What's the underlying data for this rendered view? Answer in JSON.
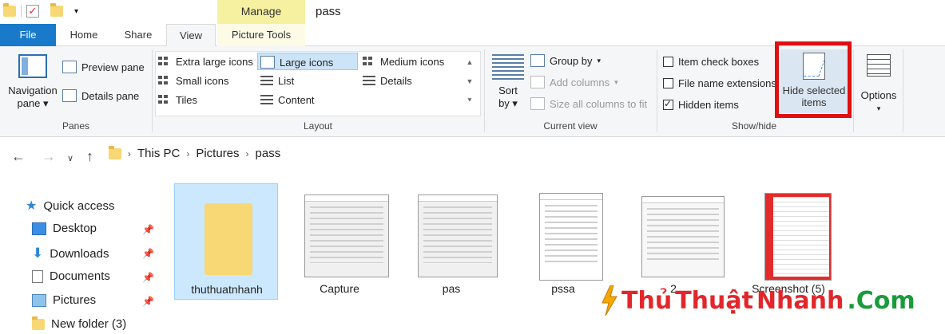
{
  "window": {
    "title": "pass",
    "context_tab_group": "Manage"
  },
  "tabs": [
    {
      "label": "File"
    },
    {
      "label": "Home"
    },
    {
      "label": "Share"
    },
    {
      "label": "View"
    },
    {
      "label": "Picture Tools"
    }
  ],
  "ribbon": {
    "panes": {
      "label": "Panes",
      "navigation_pane": "Navigation pane",
      "navigation_pane_line1": "Navigation",
      "navigation_pane_line2": "pane",
      "preview_pane": "Preview pane",
      "details_pane": "Details pane"
    },
    "layout": {
      "label": "Layout",
      "items": [
        "Extra large icons",
        "Large icons",
        "Medium icons",
        "Small icons",
        "List",
        "Details",
        "Tiles",
        "Content"
      ],
      "selected": "Large icons"
    },
    "current_view": {
      "label": "Current view",
      "sort_by_line1": "Sort",
      "sort_by_line2": "by",
      "group_by": "Group by",
      "add_columns": "Add columns",
      "size_all_columns": "Size all columns to fit"
    },
    "show_hide": {
      "label": "Show/hide",
      "item_check_boxes": "Item check boxes",
      "item_check_boxes_checked": false,
      "file_name_extensions": "File name extensions",
      "file_name_extensions_checked": false,
      "hidden_items": "Hidden items",
      "hidden_items_checked": true,
      "hide_selected_line1": "Hide selected",
      "hide_selected_line2": "items"
    },
    "options": {
      "label": "Options"
    }
  },
  "address": {
    "crumbs": [
      "This PC",
      "Pictures",
      "pass"
    ]
  },
  "nav_pane": {
    "items": [
      {
        "label": "Quick access",
        "icon": "star-icon"
      },
      {
        "label": "Desktop",
        "icon": "desktop-icon",
        "pinned": true
      },
      {
        "label": "Downloads",
        "icon": "download-icon",
        "pinned": true
      },
      {
        "label": "Documents",
        "icon": "documents-icon",
        "pinned": true
      },
      {
        "label": "Pictures",
        "icon": "pictures-icon",
        "pinned": true
      },
      {
        "label": "New folder (3)",
        "icon": "folder-icon"
      }
    ]
  },
  "files": [
    {
      "name": "thuthuatnhanh",
      "type": "folder",
      "selected": true
    },
    {
      "name": "Capture",
      "type": "image"
    },
    {
      "name": "pas",
      "type": "image"
    },
    {
      "name": "pssa",
      "type": "image"
    },
    {
      "name": "2",
      "type": "image"
    },
    {
      "name": "Screenshot (5)",
      "type": "image"
    }
  ],
  "watermark": {
    "part1": "Thủ",
    "part2": "Thuật",
    "part3": "Nhanh",
    "part4": ".Com"
  },
  "colors": {
    "accent": "#1979ca",
    "highlight": "#e01010",
    "manage_tab": "#f6f0a1"
  }
}
